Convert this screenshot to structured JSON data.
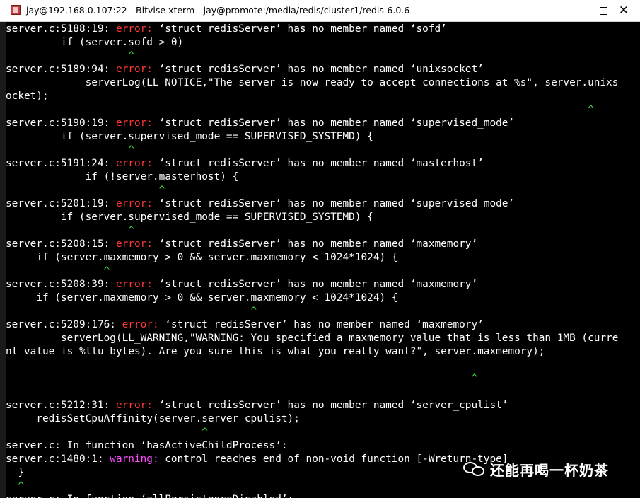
{
  "window": {
    "title": "jay@192.168.0.107:22 - Bitvise xterm - jay@promote:/media/redis/cluster1/redis-6.0.6",
    "icon": "terminal-app-icon",
    "controls": [
      "minimize",
      "maximize",
      "close"
    ],
    "close_glyph": "✕"
  },
  "colors": {
    "background": "#000000",
    "text": "#ffffff",
    "error": "#ff3838",
    "warning": "#ff4cff",
    "caret": "#3fdc3f"
  },
  "terminal": {
    "lines": [
      {
        "pre": "server.c:5188:19: ",
        "kind": "error",
        "label": "error:",
        "post": " ‘struct redisServer’ has no member named ‘sofd’"
      },
      {
        "text": "         if (server.sofd > 0)"
      },
      {
        "caret": "                    ^"
      },
      {
        "pre": "server.c:5189:94: ",
        "kind": "error",
        "label": "error:",
        "post": " ‘struct redisServer’ has no member named ‘unixsocket’"
      },
      {
        "text": "             serverLog(LL_NOTICE,\"The server is now ready to accept connections at %s\", server.unixs"
      },
      {
        "text": "ocket);"
      },
      {
        "caret": "                                                                                               ^"
      },
      {
        "pre": "server.c:5190:19: ",
        "kind": "error",
        "label": "error:",
        "post": " ‘struct redisServer’ has no member named ‘supervised_mode’"
      },
      {
        "text": "         if (server.supervised_mode == SUPERVISED_SYSTEMD) {"
      },
      {
        "caret": "                    ^"
      },
      {
        "pre": "server.c:5191:24: ",
        "kind": "error",
        "label": "error:",
        "post": " ‘struct redisServer’ has no member named ‘masterhost’"
      },
      {
        "text": "             if (!server.masterhost) {"
      },
      {
        "caret": "                         ^"
      },
      {
        "pre": "server.c:5201:19: ",
        "kind": "error",
        "label": "error:",
        "post": " ‘struct redisServer’ has no member named ‘supervised_mode’"
      },
      {
        "text": "         if (server.supervised_mode == SUPERVISED_SYSTEMD) {"
      },
      {
        "caret": "                    ^"
      },
      {
        "pre": "server.c:5208:15: ",
        "kind": "error",
        "label": "error:",
        "post": " ‘struct redisServer’ has no member named ‘maxmemory’"
      },
      {
        "text": "     if (server.maxmemory > 0 && server.maxmemory < 1024*1024) {"
      },
      {
        "caret": "                ^"
      },
      {
        "pre": "server.c:5208:39: ",
        "kind": "error",
        "label": "error:",
        "post": " ‘struct redisServer’ has no member named ‘maxmemory’"
      },
      {
        "text": "     if (server.maxmemory > 0 && server.maxmemory < 1024*1024) {"
      },
      {
        "caret": "                                        ^"
      },
      {
        "pre": "server.c:5209:176: ",
        "kind": "error",
        "label": "error:",
        "post": " ‘struct redisServer’ has no member named ‘maxmemory’"
      },
      {
        "text": "         serverLog(LL_WARNING,\"WARNING: You specified a maxmemory value that is less than 1MB (curre"
      },
      {
        "text": "nt value is %llu bytes). Are you sure this is what you really want?\", server.maxmemory);"
      },
      {
        "text": ""
      },
      {
        "caret": "                                                                            ^"
      },
      {
        "text": ""
      },
      {
        "pre": "server.c:5212:31: ",
        "kind": "error",
        "label": "error:",
        "post": " ‘struct redisServer’ has no member named ‘server_cpulist’"
      },
      {
        "text": "     redisSetCpuAffinity(server.server_cpulist);"
      },
      {
        "caret": "                                ^"
      },
      {
        "text": "server.c: In function ‘hasActiveChildProcess’:"
      },
      {
        "pre": "server.c:1480:1: ",
        "kind": "warning",
        "label": "warning:",
        "post": " control reaches end of non-void function [-Wreturn-type]"
      },
      {
        "text": "  }"
      },
      {
        "caret": "  ^"
      },
      {
        "text": "server.c: In function ‘allPersistenceDisabled’:"
      }
    ]
  },
  "watermark": {
    "icon": "wechat-icon",
    "text": "还能再喝一杯奶茶"
  }
}
